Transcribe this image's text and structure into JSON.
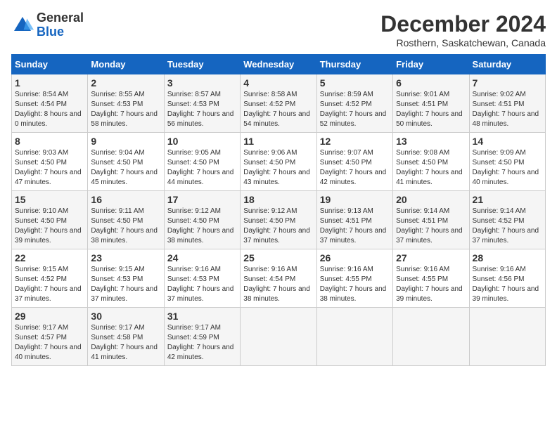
{
  "logo": {
    "general": "General",
    "blue": "Blue"
  },
  "title": "December 2024",
  "location": "Rosthern, Saskatchewan, Canada",
  "columns": [
    "Sunday",
    "Monday",
    "Tuesday",
    "Wednesday",
    "Thursday",
    "Friday",
    "Saturday"
  ],
  "weeks": [
    [
      {
        "day": "1",
        "sunrise": "8:54 AM",
        "sunset": "4:54 PM",
        "daylight": "8 hours and 0 minutes."
      },
      {
        "day": "2",
        "sunrise": "8:55 AM",
        "sunset": "4:53 PM",
        "daylight": "7 hours and 58 minutes."
      },
      {
        "day": "3",
        "sunrise": "8:57 AM",
        "sunset": "4:53 PM",
        "daylight": "7 hours and 56 minutes."
      },
      {
        "day": "4",
        "sunrise": "8:58 AM",
        "sunset": "4:52 PM",
        "daylight": "7 hours and 54 minutes."
      },
      {
        "day": "5",
        "sunrise": "8:59 AM",
        "sunset": "4:52 PM",
        "daylight": "7 hours and 52 minutes."
      },
      {
        "day": "6",
        "sunrise": "9:01 AM",
        "sunset": "4:51 PM",
        "daylight": "7 hours and 50 minutes."
      },
      {
        "day": "7",
        "sunrise": "9:02 AM",
        "sunset": "4:51 PM",
        "daylight": "7 hours and 48 minutes."
      }
    ],
    [
      {
        "day": "8",
        "sunrise": "9:03 AM",
        "sunset": "4:50 PM",
        "daylight": "7 hours and 47 minutes."
      },
      {
        "day": "9",
        "sunrise": "9:04 AM",
        "sunset": "4:50 PM",
        "daylight": "7 hours and 45 minutes."
      },
      {
        "day": "10",
        "sunrise": "9:05 AM",
        "sunset": "4:50 PM",
        "daylight": "7 hours and 44 minutes."
      },
      {
        "day": "11",
        "sunrise": "9:06 AM",
        "sunset": "4:50 PM",
        "daylight": "7 hours and 43 minutes."
      },
      {
        "day": "12",
        "sunrise": "9:07 AM",
        "sunset": "4:50 PM",
        "daylight": "7 hours and 42 minutes."
      },
      {
        "day": "13",
        "sunrise": "9:08 AM",
        "sunset": "4:50 PM",
        "daylight": "7 hours and 41 minutes."
      },
      {
        "day": "14",
        "sunrise": "9:09 AM",
        "sunset": "4:50 PM",
        "daylight": "7 hours and 40 minutes."
      }
    ],
    [
      {
        "day": "15",
        "sunrise": "9:10 AM",
        "sunset": "4:50 PM",
        "daylight": "7 hours and 39 minutes."
      },
      {
        "day": "16",
        "sunrise": "9:11 AM",
        "sunset": "4:50 PM",
        "daylight": "7 hours and 38 minutes."
      },
      {
        "day": "17",
        "sunrise": "9:12 AM",
        "sunset": "4:50 PM",
        "daylight": "7 hours and 38 minutes."
      },
      {
        "day": "18",
        "sunrise": "9:12 AM",
        "sunset": "4:50 PM",
        "daylight": "7 hours and 37 minutes."
      },
      {
        "day": "19",
        "sunrise": "9:13 AM",
        "sunset": "4:51 PM",
        "daylight": "7 hours and 37 minutes."
      },
      {
        "day": "20",
        "sunrise": "9:14 AM",
        "sunset": "4:51 PM",
        "daylight": "7 hours and 37 minutes."
      },
      {
        "day": "21",
        "sunrise": "9:14 AM",
        "sunset": "4:52 PM",
        "daylight": "7 hours and 37 minutes."
      }
    ],
    [
      {
        "day": "22",
        "sunrise": "9:15 AM",
        "sunset": "4:52 PM",
        "daylight": "7 hours and 37 minutes."
      },
      {
        "day": "23",
        "sunrise": "9:15 AM",
        "sunset": "4:53 PM",
        "daylight": "7 hours and 37 minutes."
      },
      {
        "day": "24",
        "sunrise": "9:16 AM",
        "sunset": "4:53 PM",
        "daylight": "7 hours and 37 minutes."
      },
      {
        "day": "25",
        "sunrise": "9:16 AM",
        "sunset": "4:54 PM",
        "daylight": "7 hours and 38 minutes."
      },
      {
        "day": "26",
        "sunrise": "9:16 AM",
        "sunset": "4:55 PM",
        "daylight": "7 hours and 38 minutes."
      },
      {
        "day": "27",
        "sunrise": "9:16 AM",
        "sunset": "4:55 PM",
        "daylight": "7 hours and 39 minutes."
      },
      {
        "day": "28",
        "sunrise": "9:16 AM",
        "sunset": "4:56 PM",
        "daylight": "7 hours and 39 minutes."
      }
    ],
    [
      {
        "day": "29",
        "sunrise": "9:17 AM",
        "sunset": "4:57 PM",
        "daylight": "7 hours and 40 minutes."
      },
      {
        "day": "30",
        "sunrise": "9:17 AM",
        "sunset": "4:58 PM",
        "daylight": "7 hours and 41 minutes."
      },
      {
        "day": "31",
        "sunrise": "9:17 AM",
        "sunset": "4:59 PM",
        "daylight": "7 hours and 42 minutes."
      },
      null,
      null,
      null,
      null
    ]
  ]
}
